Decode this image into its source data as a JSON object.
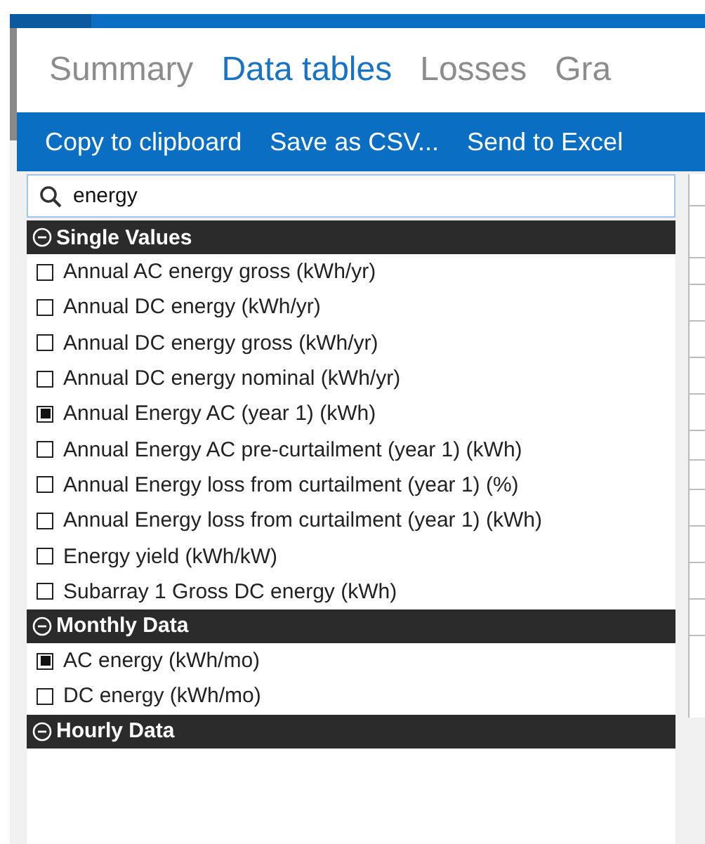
{
  "tabs": [
    {
      "label": "Summary",
      "selected": false
    },
    {
      "label": "Data tables",
      "selected": true
    },
    {
      "label": "Losses",
      "selected": false
    },
    {
      "label": "Gra",
      "selected": false
    }
  ],
  "toolbar": [
    "Copy to clipboard",
    "Save as CSV...",
    "Send to Excel"
  ],
  "search": {
    "value": "energy"
  },
  "groups": [
    {
      "title": "Single Values",
      "expanded": true,
      "items": [
        {
          "label": "Annual AC energy gross (kWh/yr)",
          "checked": false
        },
        {
          "label": "Annual DC energy (kWh/yr)",
          "checked": false
        },
        {
          "label": "Annual DC energy gross (kWh/yr)",
          "checked": false
        },
        {
          "label": "Annual DC energy nominal (kWh/yr)",
          "checked": false
        },
        {
          "label": "Annual Energy AC (year 1) (kWh)",
          "checked": true
        },
        {
          "label": "Annual Energy AC pre-curtailment (year 1) (kWh)",
          "checked": false
        },
        {
          "label": "Annual Energy loss from curtailment (year 1) (%)",
          "checked": false
        },
        {
          "label": "Annual Energy loss from curtailment (year 1) (kWh)",
          "checked": false
        },
        {
          "label": "Energy yield (kWh/kW)",
          "checked": false
        },
        {
          "label": "Subarray 1 Gross DC energy (kWh)",
          "checked": false
        }
      ]
    },
    {
      "title": "Monthly Data",
      "expanded": true,
      "items": [
        {
          "label": "AC energy (kWh/mo)",
          "checked": true
        },
        {
          "label": "DC energy (kWh/mo)",
          "checked": false
        }
      ]
    },
    {
      "title": "Hourly Data",
      "expanded": true
    }
  ]
}
